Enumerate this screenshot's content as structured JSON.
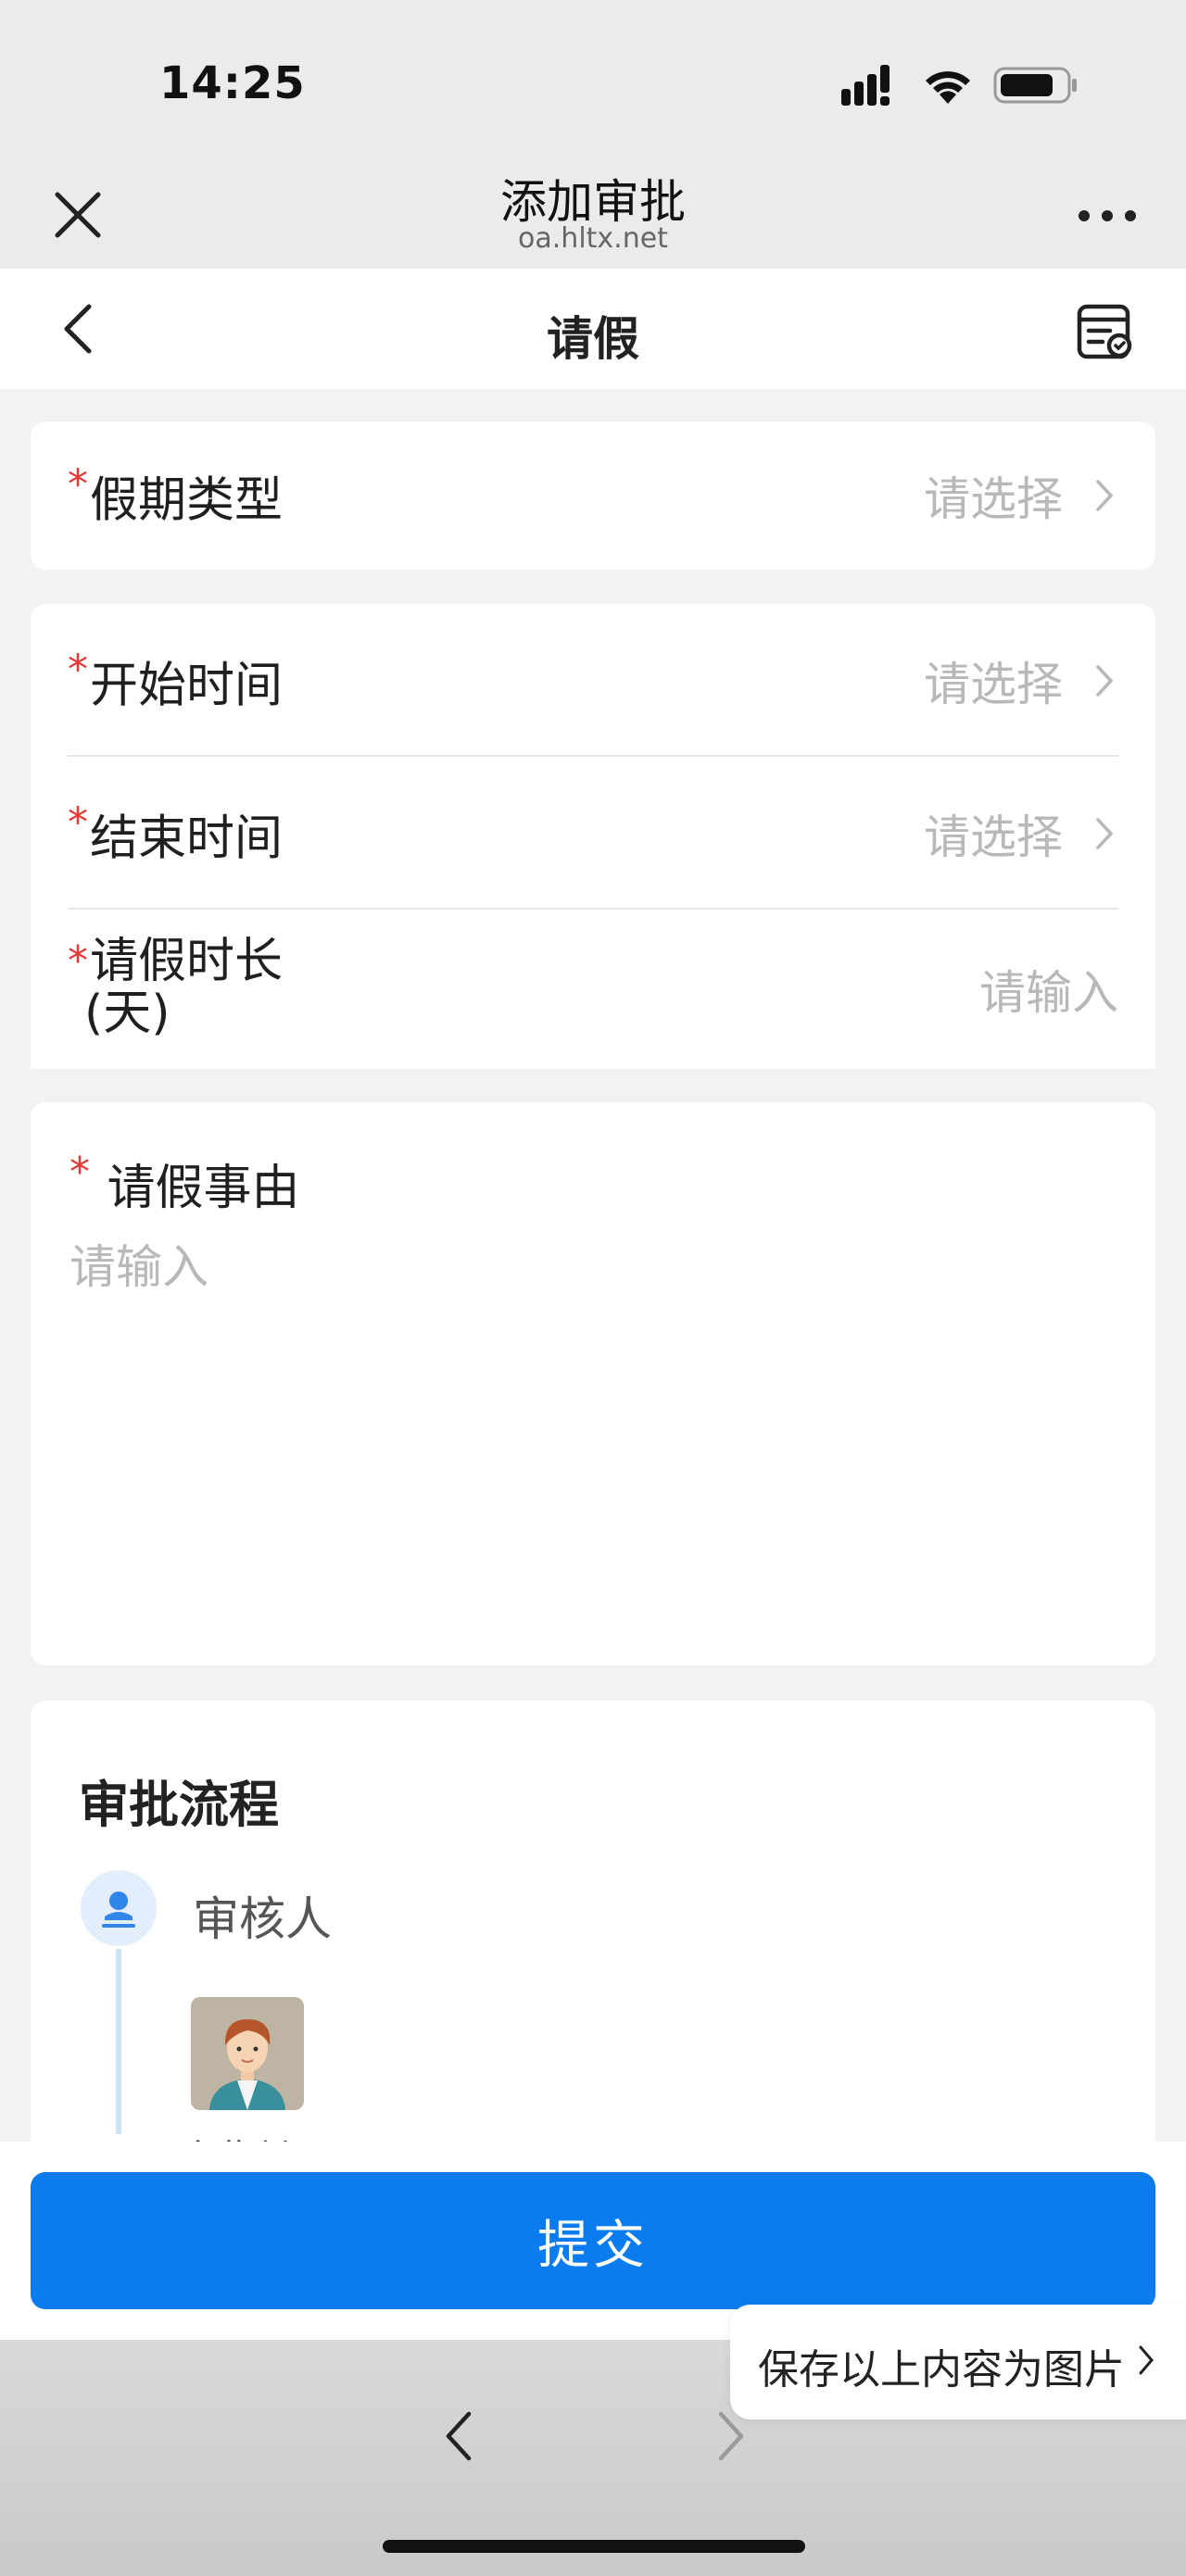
{
  "status_bar": {
    "time": "14:25"
  },
  "webview": {
    "title": "添加审批",
    "url": "oa.hltx.net"
  },
  "nav": {
    "title": "请假"
  },
  "form": {
    "vacation_type": {
      "label": "假期类型",
      "placeholder": "请选择"
    },
    "start_time": {
      "label": "开始时间",
      "placeholder": "请选择"
    },
    "end_time": {
      "label": "结束时间",
      "placeholder": "请选择"
    },
    "duration": {
      "label_line1": "请假时长",
      "label_line2": "(天)",
      "placeholder": "请输入"
    },
    "reason": {
      "label": "请假事由",
      "placeholder": "请输入"
    },
    "required_mark": "*"
  },
  "flow": {
    "title": "审批流程",
    "node_label": "审核人",
    "approver_name": "金此创"
  },
  "actions": {
    "submit": "提交",
    "save_as_image": "保存以上内容为图片"
  },
  "colors": {
    "accent": "#0a7cf0",
    "required": "#e53935",
    "placeholder": "#b8b8b8"
  }
}
